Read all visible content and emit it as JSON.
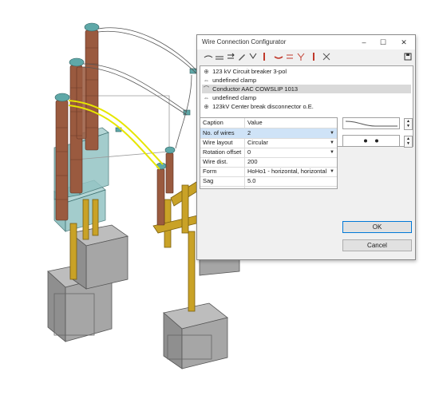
{
  "dialog": {
    "title": "Wire Connection Configurator",
    "controls": {
      "minimize": "–",
      "maximize": "☐",
      "close": "✕"
    },
    "toolbar_icons": [
      "wire-icon",
      "wire-icon",
      "wire-icon",
      "edit-icon",
      "tool-icon",
      "wire-icon",
      "wire-icon",
      "wire-icon",
      "clamp-icon",
      "pin-icon",
      "delete-icon",
      "save-icon"
    ],
    "items": [
      {
        "icon": "breaker-icon",
        "label": "123 kV Circuit breaker 3-pol"
      },
      {
        "icon": "clamp-icon",
        "label": "undefined clamp"
      },
      {
        "icon": "conductor-icon",
        "label": "Conductor AAC COWSLIP 1013",
        "selected": true
      },
      {
        "icon": "clamp-icon",
        "label": "undefined clamp"
      },
      {
        "icon": "disconnector-icon",
        "label": "123kV Center break disconnector o.E."
      }
    ],
    "grid": {
      "header": {
        "caption": "Caption",
        "value": "Value"
      },
      "rows": [
        {
          "caption": "No. of wires",
          "value": "2",
          "dropdown": true
        },
        {
          "caption": "Wire layout",
          "value": "Circular",
          "dropdown": true
        },
        {
          "caption": "Rotation offset",
          "value": "0",
          "dropdown": true
        },
        {
          "caption": "Wire dist.",
          "value": "200",
          "dropdown": false
        },
        {
          "caption": "Form",
          "value": "HoHo1 - horizontal, horizontal",
          "dropdown": true
        },
        {
          "caption": "Sag",
          "value": "5.0",
          "dropdown": false
        }
      ]
    },
    "buttons": {
      "ok": "OK",
      "cancel": "Cancel"
    }
  },
  "colors": {
    "concrete": "#a6a6a6",
    "steel": "#c9a227",
    "insulator": "#9a5a3f",
    "glass": "#7fb8b8",
    "highlight_wire": "#e6e600"
  }
}
